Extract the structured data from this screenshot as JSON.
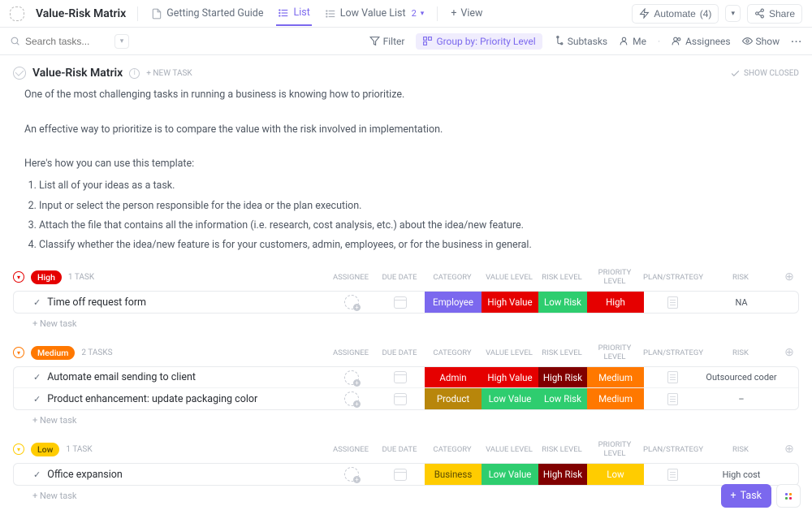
{
  "topbar": {
    "title": "Value-Risk Matrix",
    "tabs": {
      "guide": "Getting Started Guide",
      "list": "List",
      "lowvalue": "Low Value List",
      "lowvalue_count": "2",
      "view": "View"
    },
    "automate": "Automate",
    "automate_count": "(4)",
    "share": "Share"
  },
  "filterbar": {
    "search_placeholder": "Search tasks...",
    "filter": "Filter",
    "groupby": "Group by: Priority Level",
    "subtasks": "Subtasks",
    "me": "Me",
    "assignees": "Assignees",
    "show": "Show"
  },
  "header": {
    "title": "Value-Risk Matrix",
    "new_task": "+ NEW TASK",
    "show_closed": "SHOW CLOSED"
  },
  "description": {
    "p1": "One of the most challenging tasks in running a business is knowing how to prioritize.",
    "p2": "An effective way to prioritize is to compare the value with the risk involved in implementation.",
    "p3": "Here's how you can use this template:",
    "li1": "List all of your ideas as a task.",
    "li2": "Input or select the person responsible for the idea or the plan execution.",
    "li3": "Attach the file that contains all the information (i.e. research, cost analysis, etc.) about the idea/new feature.",
    "li4": "Classify whether the idea/new feature is for your customers, admin, employees, or for the business in general."
  },
  "columns": {
    "assignee": "ASSIGNEE",
    "duedate": "DUE DATE",
    "category": "CATEGORY",
    "valuelevel": "VALUE LEVEL",
    "risklevel": "RISK LEVEL",
    "prioritylevel": "PRIORITY LEVEL",
    "plan": "PLAN/STRATEGY",
    "risk": "RISK"
  },
  "groups": {
    "high": {
      "label": "High",
      "color": "#e50000",
      "count": "1 TASK",
      "tasks": [
        {
          "name": "Time off request form",
          "cat": "Employee",
          "cat_bg": "#7b68ee",
          "val": "High Value",
          "val_bg": "#e50000",
          "riskl": "Low Risk",
          "riskl_bg": "#2ecd6f",
          "prio": "High",
          "prio_bg": "#e50000",
          "risk": "NA"
        }
      ]
    },
    "medium": {
      "label": "Medium",
      "color": "#ff7800",
      "count": "2 TASKS",
      "tasks": [
        {
          "name": "Automate email sending to client",
          "cat": "Admin",
          "cat_bg": "#e50000",
          "val": "High Value",
          "val_bg": "#e50000",
          "riskl": "High Risk",
          "riskl_bg": "#800000",
          "prio": "Medium",
          "prio_bg": "#ff7800",
          "risk": "Outsourced coder"
        },
        {
          "name": "Product enhancement: update packaging color",
          "cat": "Product",
          "cat_bg": "#b8860b",
          "val": "Low Value",
          "val_bg": "#2ecd6f",
          "riskl": "Low Risk",
          "riskl_bg": "#2ecd6f",
          "prio": "Medium",
          "prio_bg": "#ff7800",
          "risk": "–"
        }
      ]
    },
    "low": {
      "label": "Low",
      "color": "#ffcc00",
      "count": "1 TASK",
      "tasks": [
        {
          "name": "Office expansion",
          "cat": "Business",
          "cat_bg": "#ffcc00",
          "val": "Low Value",
          "val_bg": "#2ecd6f",
          "riskl": "High Risk",
          "riskl_bg": "#800000",
          "prio": "Low",
          "prio_bg": "#ffcc00",
          "risk": "High cost"
        }
      ]
    }
  },
  "new_row": "+ New task",
  "fab": {
    "task": "Task"
  }
}
